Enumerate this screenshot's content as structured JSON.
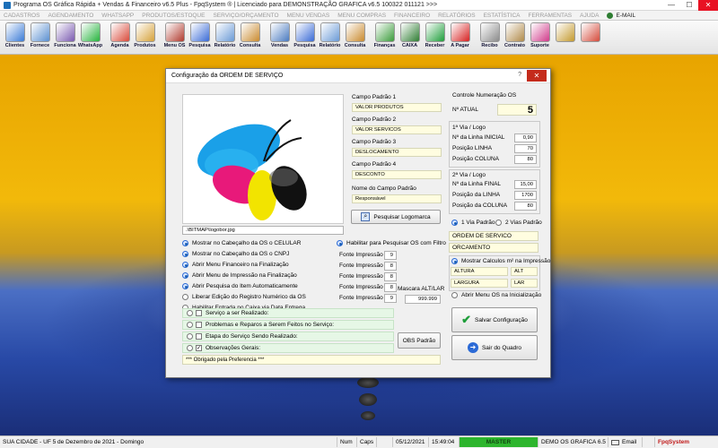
{
  "window": {
    "title": "Programa OS Gráfica Rápida + Vendas & Financeiro v6.5 Plus - FpqSystem ® | Licenciado para  DEMONSTRAÇÃO GRAFICA v6.5 100322 011121 >>>",
    "min": "—",
    "max": "☐",
    "close": "✕"
  },
  "menu": [
    "CADASTROS",
    "AGENDAMENTO",
    "WHATSAPP",
    "PRODUTOS/ESTOQUE",
    "SERVIÇO/ORÇAMENTO",
    "MENU VENDAS",
    "MENU COMPRAS",
    "FINANCEIRO",
    "RELATÓRIOS",
    "ESTATÍSTICA",
    "FERRAMENTAS",
    "AJUDA",
    "E-MAIL"
  ],
  "toolbar": [
    {
      "label": "Clientes",
      "color": "#3b7bd6"
    },
    {
      "label": "Fornece",
      "color": "#5a8fd0"
    },
    {
      "label": "Funciona",
      "color": "#7a5ab0"
    },
    {
      "label": "WhatsApp",
      "color": "#25b33c"
    },
    {
      "label": "Agenda",
      "color": "#d84a3a"
    },
    {
      "label": "Produtos",
      "color": "#d6a23a"
    },
    {
      "label": "Menu OS",
      "color": "#b03a2e"
    },
    {
      "label": "Pesquisa",
      "color": "#3a6bd6"
    },
    {
      "label": "Relatório",
      "color": "#6a9ad6"
    },
    {
      "label": "Consulta",
      "color": "#c98a2e"
    },
    {
      "label": "Vendas",
      "color": "#4a7ac0"
    },
    {
      "label": "Pesquisa",
      "color": "#3a6bd6"
    },
    {
      "label": "Relatório",
      "color": "#6a9ad6"
    },
    {
      "label": "Consulta",
      "color": "#c98a2e"
    },
    {
      "label": "Finanças",
      "color": "#3b9c3b"
    },
    {
      "label": "CAIXA",
      "color": "#2e7d32"
    },
    {
      "label": "Receber",
      "color": "#1e9e3a"
    },
    {
      "label": "A Pagar",
      "color": "#d62020"
    },
    {
      "label": "Recibo",
      "color": "#8a8a8a"
    },
    {
      "label": "Contrato",
      "color": "#b08a4a"
    },
    {
      "label": "Suporte",
      "color": "#d03a8a"
    },
    {
      "label": "",
      "color": "#c49a2e"
    },
    {
      "label": "",
      "color": "#d44a3a"
    }
  ],
  "dialog": {
    "title": "Configuração da ORDEM DE SERVIÇO",
    "help": "?",
    "close": "✕",
    "logo_path": ".\\BITMAP\\logobor.jpg",
    "campos": [
      {
        "label": "Campo Padrão 1",
        "value": "VALOR PRODUTOS"
      },
      {
        "label": "Campo Padrão 2",
        "value": "VALOR SERVICOS"
      },
      {
        "label": "Campo Padrão 3",
        "value": "DESLOCAMENTO"
      },
      {
        "label": "Campo Padrão 4",
        "value": "DESCONTO"
      }
    ],
    "nome_campo_label": "Nome do Campo Padrão",
    "nome_campo_value": "Responsável",
    "pesquisar_logo": "Pesquisar Logomarca",
    "controle_label": "Controle Numeração OS",
    "n_atual_label": "Nº ATUAL",
    "n_atual_value": "5",
    "via1_label": "1ª Via / Logo",
    "via1_rows": [
      {
        "label": "Nº da Linha INICIAL",
        "value": "0,90"
      },
      {
        "label": "Posição LINHA",
        "value": "70"
      },
      {
        "label": "Posição COLUNA",
        "value": "80"
      }
    ],
    "via2_label": "2ª Via / Logo",
    "via2_rows": [
      {
        "label": "Nº da Linha FINAL",
        "value": "15,00"
      },
      {
        "label": "Posição da LINHA",
        "value": "1700"
      },
      {
        "label": "Posição da COLUNA",
        "value": "80"
      }
    ],
    "via_padrao_1": "1 Via Padrão",
    "via_padrao_2": "2 Vias Padrão",
    "doc_field_1": "ORDEM DE SERVICO",
    "doc_field_2": "ORCAMENTO",
    "mostrar_calculos": "Mostrar Calculos m² na Impressão",
    "altura": "ALTURA",
    "alt": "ALT",
    "largura": "LARGURA",
    "lar": "LAR",
    "abrir_menu_os": "Abrir Menu OS na Inicialização",
    "options": [
      {
        "label": "Mostrar no Cabeçalho da OS o CELULAR",
        "on": true
      },
      {
        "label": "Mostrar no Cabeçalho da OS o CNPJ",
        "on": true
      },
      {
        "label": "Abrir Menu Financeiro na Finalização",
        "on": true
      },
      {
        "label": "Abrir Menu de Impressão na Finalização",
        "on": true
      },
      {
        "label": "Abrir Pesquisa do Item Automaticamente",
        "on": true
      },
      {
        "label": "Liberar Edição do Registro Numérico da OS",
        "on": false
      },
      {
        "label": "Habilitar Entrada no Caixa via Data Entrega",
        "on": false
      }
    ],
    "habilitar_pesquisar_os": "Habilitar para Pesquisar OS com Filtro",
    "fontes": [
      {
        "label": "Fonte Impressão 1",
        "value": "9"
      },
      {
        "label": "Fonte Impressão 2",
        "value": "8"
      },
      {
        "label": "Fonte Impressão 3",
        "value": "8"
      },
      {
        "label": "Fonte Impressão 4",
        "value": "8"
      },
      {
        "label": "Fonte Impressão 5",
        "value": "9"
      }
    ],
    "mascara_label": "Mascara ALT/LAR",
    "mascara_value": "999.999",
    "checks": [
      {
        "label": "Serviço a ser Realizado:",
        "checked": false
      },
      {
        "label": "Problemas e Reparos a Serem Feitos no Serviço:",
        "checked": false
      },
      {
        "label": "Etapa do Serviço Sendo Realizado:",
        "checked": false
      },
      {
        "label": "Observações Gerais:",
        "checked": true
      }
    ],
    "obs_text": "*** Obrigado pela Preferencia ***",
    "obs_padrao": "OBS Padrão",
    "salvar": "Salvar Configuração",
    "sair": "Sair do Quadro"
  },
  "status": {
    "left": "SUA CIDADE - UF  5 de Dezembro de 2021 - Domingo",
    "num": "Num",
    "caps": "Caps",
    "date": "05/12/2021",
    "time": "15:49:04",
    "master": "MASTER",
    "demo": "DEMO OS GRAFICA 6.5",
    "email": "Email",
    "brand": "FpqSystem"
  },
  "colors": {
    "accent": "#1a5fb4",
    "master": "#2db52d",
    "close": "#e81123"
  }
}
